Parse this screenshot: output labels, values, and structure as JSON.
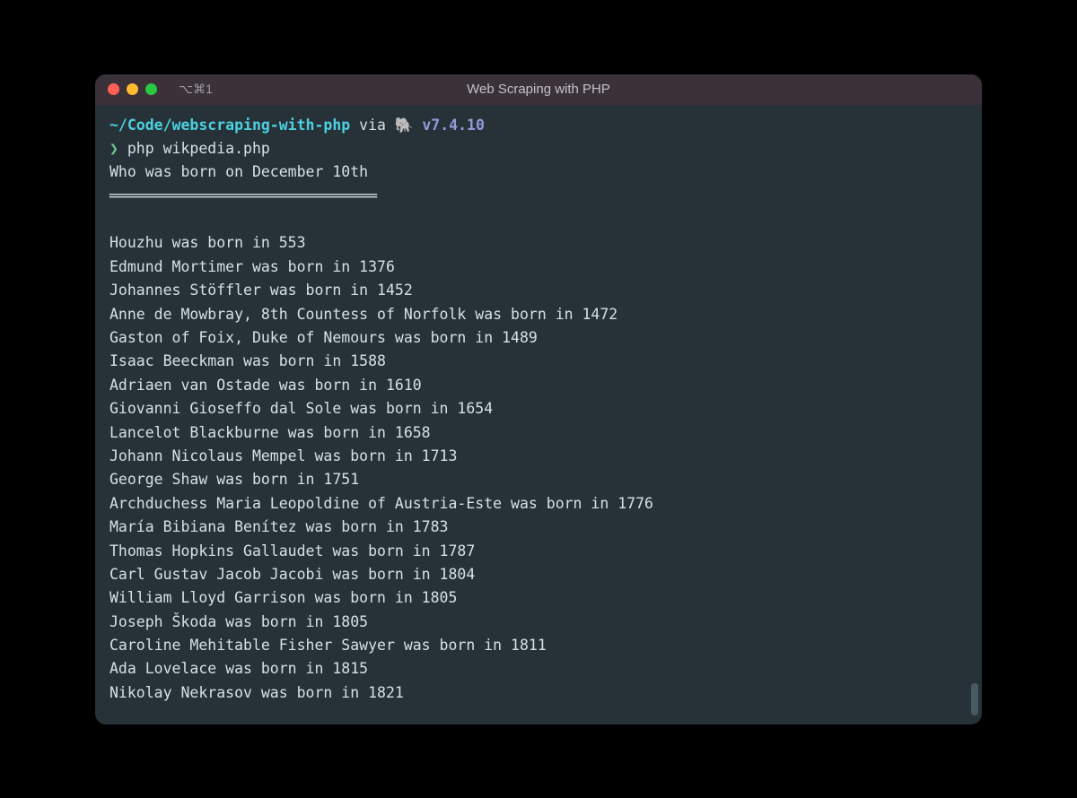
{
  "window": {
    "title": "Web Scraping with PHP",
    "tab_indicator": "⌥⌘1"
  },
  "prompt": {
    "path": "~/Code/webscraping-with-php",
    "via_text": " via ",
    "runtime_icon": "🐘",
    "version": " v7.4.10",
    "symbol": "❯",
    "command": "php wikpedia.php"
  },
  "output": {
    "header": "Who was born on December 10th",
    "divider": "══════════════════════════════",
    "lines": [
      "Houzhu was born in 553",
      "Edmund Mortimer was born in 1376",
      "Johannes Stöffler was born in 1452",
      "Anne de Mowbray, 8th Countess of Norfolk was born in 1472",
      "Gaston of Foix, Duke of Nemours was born in 1489",
      "Isaac Beeckman was born in 1588",
      "Adriaen van Ostade was born in 1610",
      "Giovanni Gioseffo dal Sole was born in 1654",
      "Lancelot Blackburne was born in 1658",
      "Johann Nicolaus Mempel was born in 1713",
      "George Shaw was born in 1751",
      "Archduchess Maria Leopoldine of Austria-Este was born in 1776",
      "María Bibiana Benítez was born in 1783",
      "Thomas Hopkins Gallaudet was born in 1787",
      "Carl Gustav Jacob Jacobi was born in 1804",
      "William Lloyd Garrison was born in 1805",
      "Joseph Škoda was born in 1805",
      "Caroline Mehitable Fisher Sawyer was born in 1811",
      "Ada Lovelace was born in 1815",
      "Nikolay Nekrasov was born in 1821"
    ]
  }
}
